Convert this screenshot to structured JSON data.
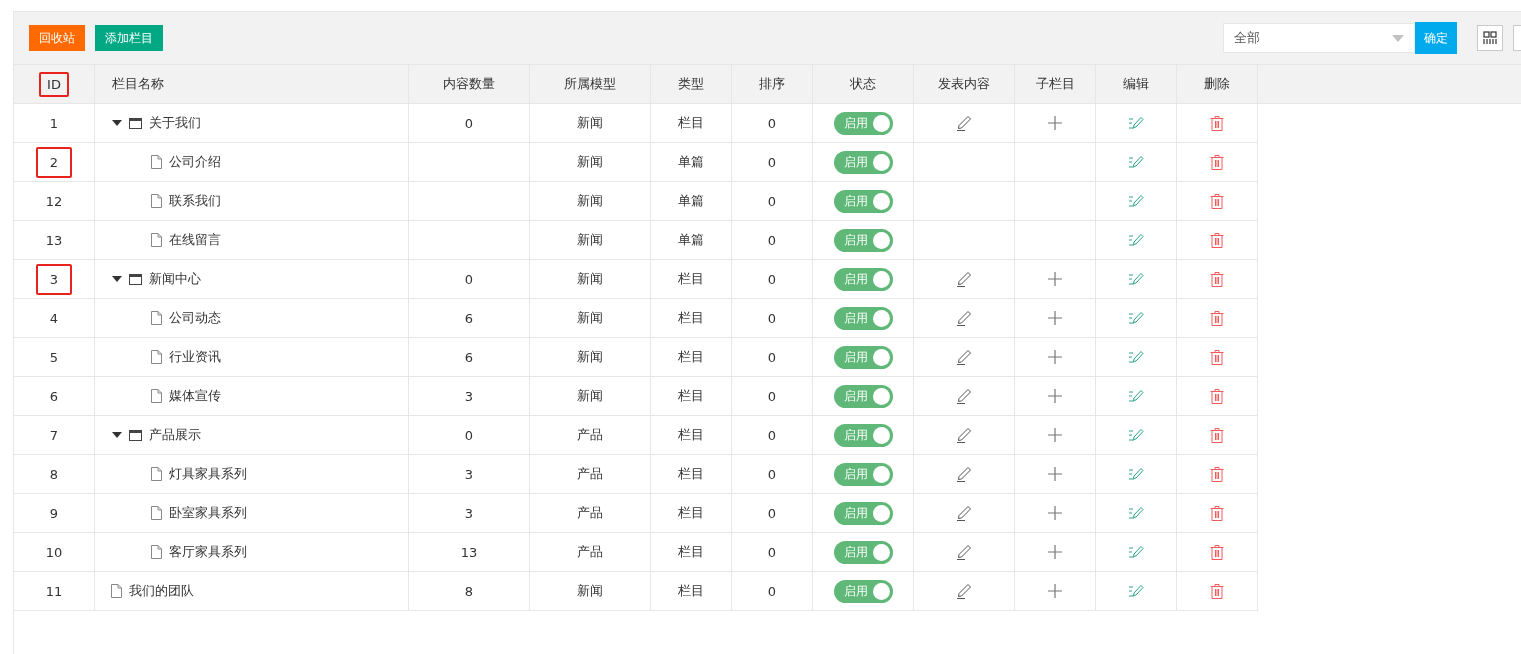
{
  "toolbar": {
    "buttons": [
      {
        "label": "回收站",
        "kind": "recycle"
      },
      {
        "label": "添加栏目",
        "kind": "add"
      }
    ],
    "filter": {
      "value": "全部"
    },
    "confirm": "确定"
  },
  "table": {
    "columns": [
      {
        "label": "ID",
        "highlighted": true
      },
      {
        "label": "栏目名称",
        "highlighted": false
      },
      {
        "label": "内容数量",
        "highlighted": false
      },
      {
        "label": "所属模型",
        "highlighted": false
      },
      {
        "label": "类型",
        "highlighted": false
      },
      {
        "label": "排序",
        "highlighted": false
      },
      {
        "label": "状态",
        "highlighted": false
      },
      {
        "label": "发表内容",
        "highlighted": false
      },
      {
        "label": "子栏目",
        "highlighted": false
      },
      {
        "label": "编辑",
        "highlighted": false
      },
      {
        "label": "删除",
        "highlighted": false
      }
    ],
    "rows": [
      {
        "id": "1",
        "name": "关于我们",
        "kind": "folder",
        "expanded": true,
        "count": "0",
        "model": "新闻",
        "type": "栏目",
        "sort": "0",
        "status": {
          "label": "启用",
          "on": true
        },
        "can_publish": true,
        "can_add_child": true,
        "highlighted": false,
        "children": [
          {
            "id": "2",
            "name": "公司介绍",
            "kind": "page",
            "model": "新闻",
            "type": "单篇",
            "sort": "0",
            "status": {
              "label": "启用",
              "on": true
            },
            "can_publish": false,
            "can_add_child": false,
            "highlighted": true
          },
          {
            "id": "12",
            "name": "联系我们",
            "kind": "page",
            "model": "新闻",
            "type": "单篇",
            "sort": "0",
            "status": {
              "label": "启用",
              "on": true
            },
            "can_publish": false,
            "can_add_child": false,
            "highlighted": false
          },
          {
            "id": "13",
            "name": "在线留言",
            "kind": "page",
            "model": "新闻",
            "type": "单篇",
            "sort": "0",
            "status": {
              "label": "启用",
              "on": true
            },
            "can_publish": false,
            "can_add_child": false,
            "highlighted": false
          }
        ]
      },
      {
        "id": "3",
        "name": "新闻中心",
        "kind": "folder",
        "expanded": true,
        "count": "0",
        "model": "新闻",
        "type": "栏目",
        "sort": "0",
        "status": {
          "label": "启用",
          "on": true
        },
        "can_publish": true,
        "can_add_child": true,
        "highlighted": true,
        "children": [
          {
            "id": "4",
            "name": "公司动态",
            "kind": "page",
            "count": "6",
            "model": "新闻",
            "type": "栏目",
            "sort": "0",
            "status": {
              "label": "启用",
              "on": true
            },
            "can_publish": true,
            "can_add_child": true,
            "highlighted": false
          },
          {
            "id": "5",
            "name": "行业资讯",
            "kind": "page",
            "count": "6",
            "model": "新闻",
            "type": "栏目",
            "sort": "0",
            "status": {
              "label": "启用",
              "on": true
            },
            "can_publish": true,
            "can_add_child": true,
            "highlighted": false
          },
          {
            "id": "6",
            "name": "媒体宣传",
            "kind": "page",
            "count": "3",
            "model": "新闻",
            "type": "栏目",
            "sort": "0",
            "status": {
              "label": "启用",
              "on": true
            },
            "can_publish": true,
            "can_add_child": true,
            "highlighted": false
          }
        ]
      },
      {
        "id": "7",
        "name": "产品展示",
        "kind": "folder",
        "expanded": true,
        "count": "0",
        "model": "产品",
        "type": "栏目",
        "sort": "0",
        "status": {
          "label": "启用",
          "on": true
        },
        "can_publish": true,
        "can_add_child": true,
        "highlighted": false,
        "children": [
          {
            "id": "8",
            "name": "灯具家具系列",
            "kind": "page",
            "count": "3",
            "model": "产品",
            "type": "栏目",
            "sort": "0",
            "status": {
              "label": "启用",
              "on": true
            },
            "can_publish": true,
            "can_add_child": true,
            "highlighted": false
          },
          {
            "id": "9",
            "name": "卧室家具系列",
            "kind": "page",
            "count": "3",
            "model": "产品",
            "type": "栏目",
            "sort": "0",
            "status": {
              "label": "启用",
              "on": true
            },
            "can_publish": true,
            "can_add_child": true,
            "highlighted": false
          },
          {
            "id": "10",
            "name": "客厅家具系列",
            "kind": "page",
            "count": "13",
            "model": "产品",
            "type": "栏目",
            "sort": "0",
            "status": {
              "label": "启用",
              "on": true
            },
            "can_publish": true,
            "can_add_child": true,
            "highlighted": false
          }
        ]
      },
      {
        "id": "11",
        "name": "我们的团队",
        "kind": "page",
        "count": "8",
        "model": "新闻",
        "type": "栏目",
        "sort": "0",
        "status": {
          "label": "启用",
          "on": true
        },
        "can_publish": true,
        "can_add_child": true,
        "highlighted": false
      }
    ]
  }
}
